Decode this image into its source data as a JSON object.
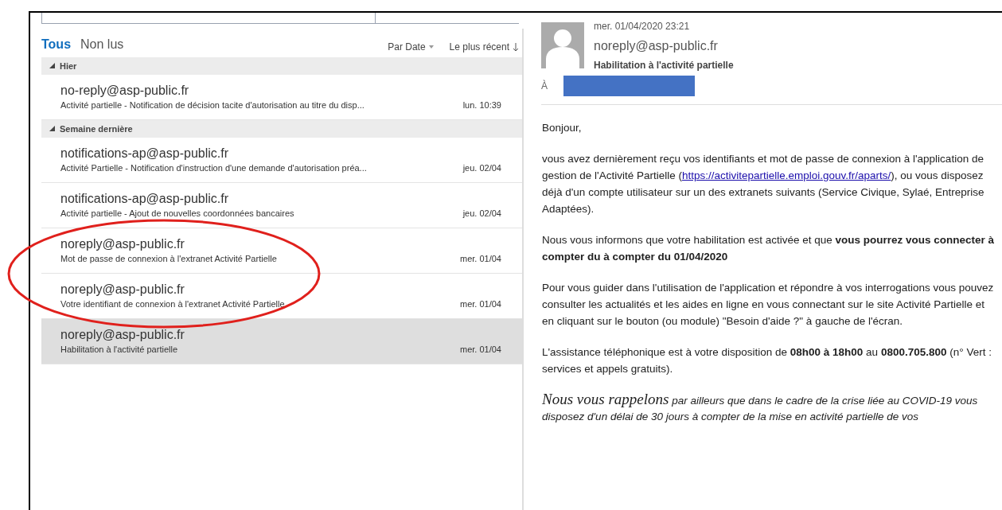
{
  "list": {
    "tabs": [
      {
        "label": "Tous",
        "selected": true
      },
      {
        "label": "Non lus",
        "selected": false
      }
    ],
    "sort": {
      "label": "Par Date",
      "order": "Le plus récent"
    },
    "groups": [
      {
        "label": "Hier",
        "expanded": true,
        "messages": [
          {
            "sender": "no-reply@asp-public.fr",
            "subject": "Activité partielle - Notification de décision tacite d'autorisation au titre du disp...",
            "date": "lun. 10:39",
            "selected": false
          }
        ]
      },
      {
        "label": "Semaine dernière",
        "expanded": true,
        "messages": [
          {
            "sender": "notifications-ap@asp-public.fr",
            "subject": "Activité Partielle - Notification d'instruction d'une demande d'autorisation préa...",
            "date": "jeu. 02/04",
            "selected": false
          },
          {
            "sender": "notifications-ap@asp-public.fr",
            "subject": "Activité partielle -  Ajout de nouvelles coordonnées bancaires",
            "date": "jeu. 02/04",
            "selected": false
          },
          {
            "sender": "noreply@asp-public.fr",
            "subject": "Mot de passe de connexion à l'extranet Activité Partielle",
            "date": "mer. 01/04",
            "selected": false
          },
          {
            "sender": "noreply@asp-public.fr",
            "subject": "Votre identifiant de connexion à l'extranet Activité Partielle",
            "date": "mer. 01/04",
            "selected": false
          },
          {
            "sender": "noreply@asp-public.fr",
            "subject": "Habilitation à l'activité partielle",
            "date": "mer. 01/04",
            "selected": true
          }
        ]
      }
    ]
  },
  "message": {
    "datetime": "mer. 01/04/2020 23:21",
    "sender": "noreply@asp-public.fr",
    "subject": "Habilitation à l'activité partielle",
    "to_label": "À",
    "paragraphs": [
      [
        {
          "kind": "text",
          "text": "Bonjour,"
        }
      ],
      [
        {
          "kind": "text",
          "text": "vous avez dernièrement reçu vos identifiants et mot de passe de connexion à l'application de gestion de l'Activité Partielle ("
        },
        {
          "kind": "link",
          "text": "https://activitepartielle.emploi.gouv.fr/aparts/"
        },
        {
          "kind": "text",
          "text": "), ou vous disposez déjà d'un compte utilisateur sur un des extranets suivants (Service Civique, Sylaé, Entreprise Adaptées)."
        }
      ],
      [
        {
          "kind": "text",
          "text": "Nous vous informons que votre habilitation est activée et que **vous pourrez vous connecter à compter du  à compter du 01/04/2020**"
        }
      ],
      [
        {
          "kind": "text",
          "text": "Pour vous guider dans l'utilisation de l'application et répondre à vos interrogations vous pouvez consulter les actualités et les aides en ligne en vous connectant sur le site Activité Partielle et en cliquant sur le bouton (ou module) \"Besoin d'aide ?\" à gauche de l'écran."
        }
      ],
      [
        {
          "kind": "text",
          "text": "L'assistance téléphonique est à votre disposition de **08h00 à 18h00** au **0800.705.800** (n° Vert : services et appels gratuits)."
        }
      ],
      [
        {
          "kind": "lead",
          "text": "Nous vous rappelons"
        },
        {
          "kind": "italic",
          "text": " par ailleurs que dans le cadre de la crise liée au COVID-19 vous disposez d'un délai de 30 jours à compter de la mise en activité partielle de vos"
        }
      ]
    ]
  }
}
